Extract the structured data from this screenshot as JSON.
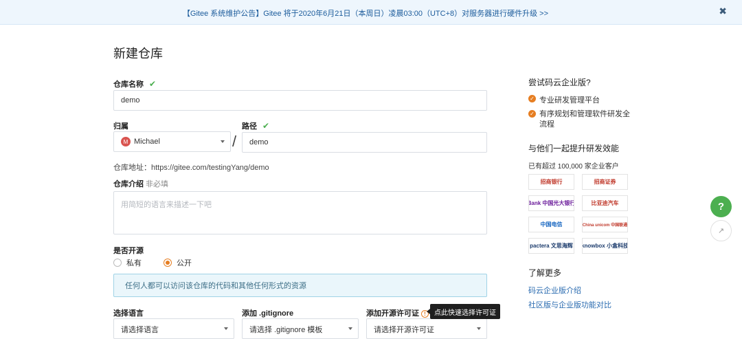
{
  "banner": {
    "text": "【Gitee 系统维护公告】Gitee 将于2020年6月21日（本周日）凌晨03:00（UTC+8）对服务器进行硬件升级 >>",
    "close": "✖"
  },
  "page_title": "新建仓库",
  "form": {
    "repo_name_label": "仓库名称",
    "repo_name_value": "demo",
    "owner_label": "归属",
    "owner_avatar": "M",
    "owner_value": "Michael",
    "slash": "/",
    "path_label": "路径",
    "path_value": "demo",
    "check": "✔",
    "address": "仓库地址：https://gitee.com/testingYang/demo",
    "intro_label": "仓库介绍",
    "intro_optional": "非必填",
    "intro_placeholder": "用简短的语言来描述一下吧",
    "open_source_label": "是否开源",
    "private_label": "私有",
    "public_label": "公开",
    "public_info": "任何人都可以访问该仓库的代码和其他任何形式的资源",
    "lang_label": "选择语言",
    "lang_placeholder": "请选择语言",
    "gitignore_label": "添加 .gitignore",
    "gitignore_placeholder": "请选择 .gitignore 模板",
    "license_label": "添加开源许可证",
    "license_placeholder": "请选择开源许可证",
    "license_tooltip": "点此快速选择许可证"
  },
  "sidebar": {
    "try_title": "尝试码云企业版?",
    "bullets": [
      "专业研发管理平台",
      "有序规划和管理软件研发全流程"
    ],
    "bullet2_line1": "有序规划和管理软件研发全",
    "bullet2_line2": "流程",
    "together_title": "与他们一起提升研发效能",
    "customers": "已有超过 100,000 家企业客户",
    "logos": [
      "招商银行",
      "招商证券",
      "Bank 中国光大银行",
      "比亚迪汽车",
      "中国电信",
      "China unicom 中国联通",
      "pactera 文思海辉",
      "knowbox 小盒科技"
    ],
    "learn_title": "了解更多",
    "links": [
      "码云企业版介绍",
      "社区版与企业版功能对比"
    ]
  },
  "floating": {
    "help": "?",
    "share": "↗"
  },
  "colors": {
    "accent": "#e67e22",
    "success": "#4caf50",
    "link": "#2a6bb0"
  }
}
